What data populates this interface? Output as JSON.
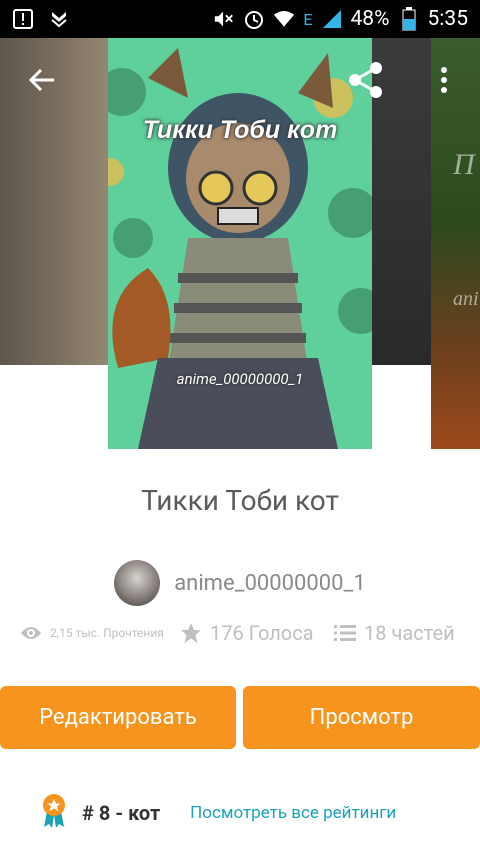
{
  "status_bar": {
    "battery": "48%",
    "time": "5:35",
    "network": "E"
  },
  "cover": {
    "title": "Тикки Тоби кот",
    "author": "anime_00000000_1"
  },
  "adjacent_cover_right": {
    "text_top": "П",
    "text_bottom": "ani"
  },
  "story": {
    "title": "Тикки Тоби кот",
    "author": "anime_00000000_1",
    "reads": "2,15 тыс. Прочтения",
    "votes": "176 Голоса",
    "parts": "18 частей"
  },
  "actions": {
    "edit_label": "Редактировать",
    "view_label": "Просмотр"
  },
  "ranking": {
    "text": "# 8 - кот",
    "link": "Посмотреть все рейтинги"
  },
  "colors": {
    "accent": "#f7941d",
    "link": "#1ba3b5",
    "title": "#5b5b5b"
  }
}
